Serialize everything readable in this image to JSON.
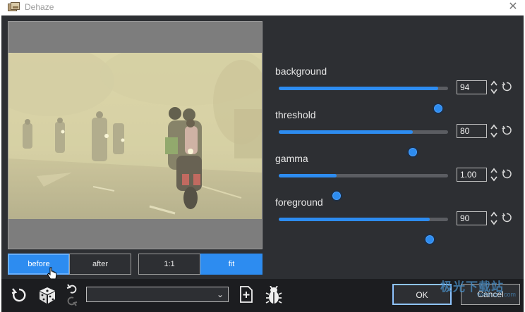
{
  "window": {
    "title": "Dehaze"
  },
  "params": [
    {
      "label": "background",
      "value": "94",
      "level": 0.94
    },
    {
      "label": "threshold",
      "value": "80",
      "level": 0.79
    },
    {
      "label": "gamma",
      "value": "1.00",
      "level": 0.34
    },
    {
      "label": "foreground",
      "value": "90",
      "level": 0.89
    }
  ],
  "view": {
    "before": "before",
    "after": "after",
    "one_to_one": "1:1",
    "fit": "fit",
    "active_zoom": "fit"
  },
  "preset": {
    "value": ""
  },
  "buttons": {
    "ok": "OK",
    "cancel": "Cancel"
  },
  "watermark": {
    "text": "极光下载站",
    "url": "www.xz7.com"
  },
  "colors": {
    "accent": "#2d8cf0",
    "panel": "#2d2f33",
    "bar": "#1c1d20"
  },
  "icons": [
    "app-icon",
    "close-icon",
    "reset-icon",
    "random-dice-icon",
    "undo-icon",
    "redo-icon",
    "chevron-down-icon",
    "add-preset-icon",
    "bug-icon",
    "spin-arrows-icon",
    "reset-value-icon",
    "hand-cursor-icon"
  ]
}
